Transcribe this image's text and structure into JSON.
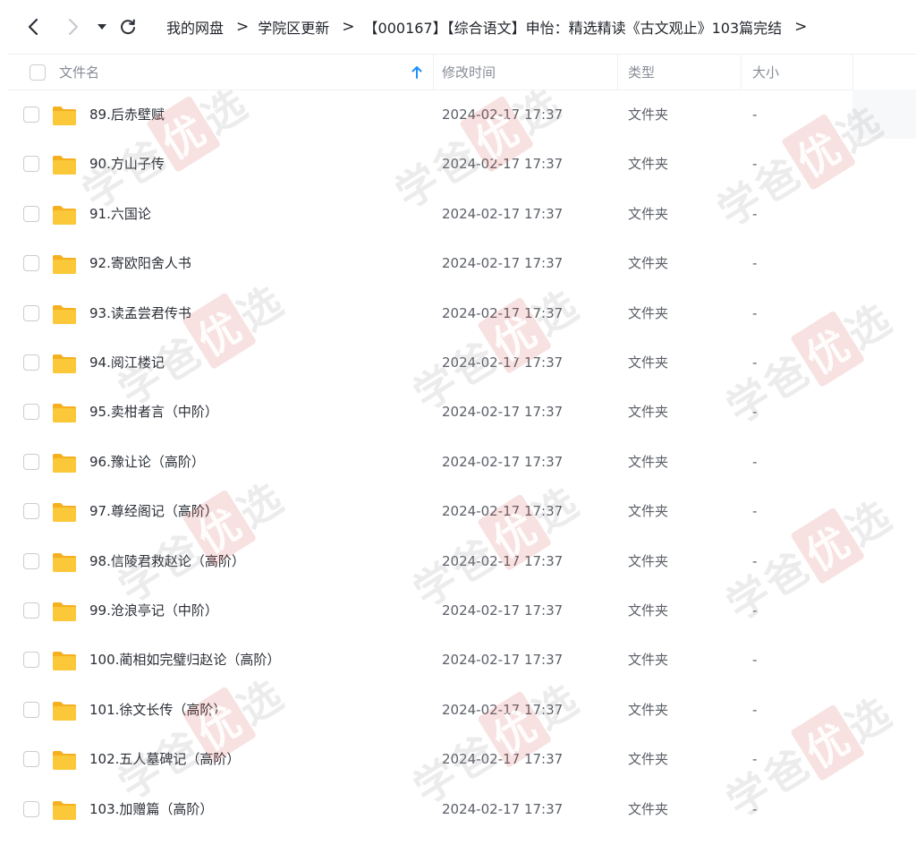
{
  "breadcrumb": [
    {
      "label": "我的网盘"
    },
    {
      "label": "学院区更新"
    },
    {
      "label": "【000167】【综合语文】申怡：精选精读《古文观止》103篇完结"
    }
  ],
  "columns": {
    "name": "文件名",
    "modified": "修改时间",
    "type": "类型",
    "size": "大小"
  },
  "sort": {
    "column": "name",
    "direction": "ascending",
    "icon": "arrow-up-icon"
  },
  "colors": {
    "accent": "#1e90ff",
    "folder": "#f9c23c"
  },
  "watermark": {
    "text_a": "学爸",
    "text_b": "优",
    "text_c": "选"
  },
  "files": [
    {
      "name": "89.后赤壁赋",
      "modified": "2024-02-17 17:37",
      "type": "文件夹",
      "size": "-"
    },
    {
      "name": "90.方山子传",
      "modified": "2024-02-17 17:37",
      "type": "文件夹",
      "size": "-"
    },
    {
      "name": "91.六国论",
      "modified": "2024-02-17 17:37",
      "type": "文件夹",
      "size": "-"
    },
    {
      "name": "92.寄欧阳舍人书",
      "modified": "2024-02-17 17:37",
      "type": "文件夹",
      "size": "-"
    },
    {
      "name": "93.读孟尝君传书",
      "modified": "2024-02-17 17:37",
      "type": "文件夹",
      "size": "-"
    },
    {
      "name": "94.阅江楼记",
      "modified": "2024-02-17 17:37",
      "type": "文件夹",
      "size": "-"
    },
    {
      "name": "95.卖柑者言（中阶）",
      "modified": "2024-02-17 17:37",
      "type": "文件夹",
      "size": "-"
    },
    {
      "name": "96.豫让论（高阶）",
      "modified": "2024-02-17 17:37",
      "type": "文件夹",
      "size": "-"
    },
    {
      "name": "97.尊经阁记（高阶）",
      "modified": "2024-02-17 17:37",
      "type": "文件夹",
      "size": "-"
    },
    {
      "name": "98.信陵君救赵论（高阶）",
      "modified": "2024-02-17 17:37",
      "type": "文件夹",
      "size": "-"
    },
    {
      "name": "99.沧浪亭记（中阶）",
      "modified": "2024-02-17 17:37",
      "type": "文件夹",
      "size": "-"
    },
    {
      "name": "100.蔺相如完璧归赵论（高阶）",
      "modified": "2024-02-17 17:37",
      "type": "文件夹",
      "size": "-"
    },
    {
      "name": "101.徐文长传（高阶）",
      "modified": "2024-02-17 17:37",
      "type": "文件夹",
      "size": "-"
    },
    {
      "name": "102.五人墓碑记（高阶）",
      "modified": "2024-02-17 17:37",
      "type": "文件夹",
      "size": "-"
    },
    {
      "name": "103.加赠篇（高阶）",
      "modified": "2024-02-17 17:37",
      "type": "文件夹",
      "size": "-"
    }
  ]
}
